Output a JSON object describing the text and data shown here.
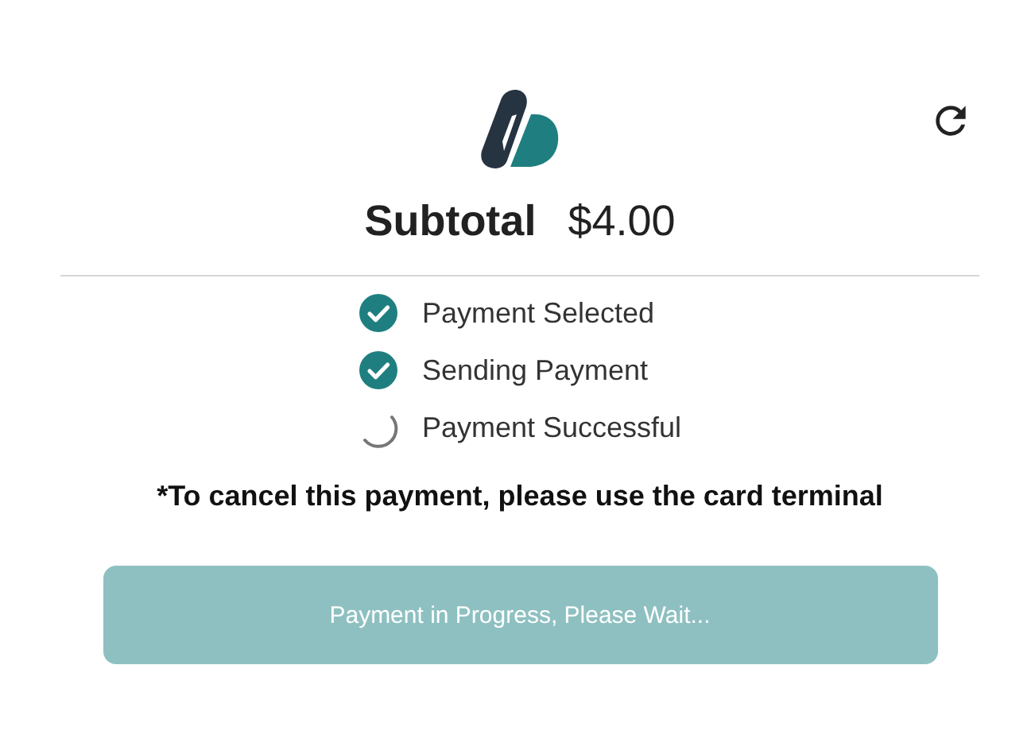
{
  "header": {
    "subtotal_label": "Subtotal",
    "subtotal_amount": "$4.00"
  },
  "steps": [
    {
      "label": "Payment Selected",
      "completed": true
    },
    {
      "label": "Sending Payment",
      "completed": true
    },
    {
      "label": "Payment Successful",
      "completed": false
    }
  ],
  "note": "*To cancel this payment, please use the card terminal",
  "button": {
    "label": "Payment in Progress, Please Wait...",
    "disabled": true
  }
}
